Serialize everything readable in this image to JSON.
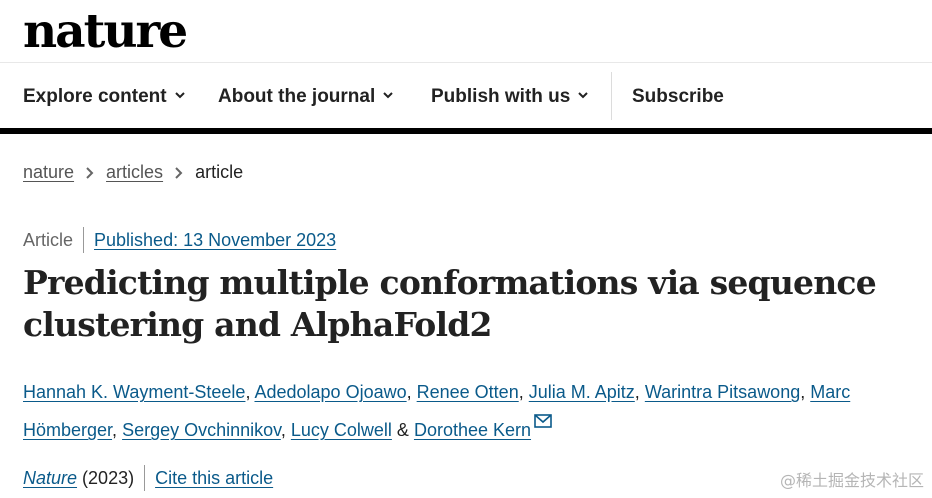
{
  "header": {
    "logo": "nature"
  },
  "nav": {
    "items": [
      {
        "label": "Explore content",
        "dropdown": true
      },
      {
        "label": "About the journal",
        "dropdown": true
      },
      {
        "label": "Publish with us",
        "dropdown": true
      },
      {
        "label": "Subscribe",
        "dropdown": false
      }
    ]
  },
  "breadcrumb": {
    "items": [
      "nature",
      "articles",
      "article"
    ]
  },
  "article": {
    "type": "Article",
    "published": "Published: 13 November 2023",
    "title": "Predicting multiple conformations via sequence clustering and AlphaFold2",
    "authors": [
      "Hannah K. Wayment-Steele",
      "Adedolapo Ojoawo",
      "Renee Otten",
      "Julia M. Apitz",
      "Warintra Pitsawong",
      "Marc Hömberger",
      "Sergey Ovchinnikov",
      "Lucy Colwell",
      "Dorothee Kern"
    ],
    "authors_separator": ",",
    "authors_conjunction": "&",
    "journal_name": "Nature",
    "journal_year": "(2023)",
    "cite_label": "Cite this article"
  },
  "watermark": "@稀土掘金技术社区",
  "colors": {
    "link": "#0a5a8a",
    "text": "#222222",
    "bar": "#000000"
  }
}
